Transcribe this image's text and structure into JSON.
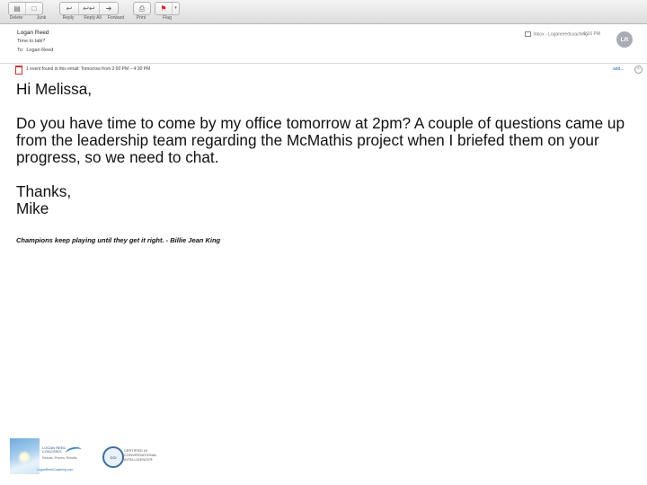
{
  "toolbar": {
    "delete": "Delete",
    "junk": "Junk",
    "reply": "Reply",
    "reply_all": "Reply All",
    "forward": "Forward",
    "print": "Print",
    "flag": "Flag"
  },
  "header": {
    "sender": "Logan Reed",
    "subject": "Time to talk?",
    "to_label": "To:",
    "to_name": "Logan Reed",
    "mailbox": "Inbox - Loganreedcoaching",
    "time": "6:16 PM",
    "avatar_initials": "LR"
  },
  "event_bar": {
    "text": "1 event found in this email: Tomorrow from 2:00 PM – 4:30 PM",
    "add": "add..."
  },
  "body": {
    "greeting": "Hi Melissa,",
    "paragraph": "Do you have time to come by my office tomorrow at 2pm?  A couple of questions came up from the leadership team regarding the McMathis project when I briefed them on your progress, so we need to chat.",
    "closing": "Thanks,",
    "name": "Mike",
    "quote": "Champions keep playing until they get it right. - Billie Jean King"
  },
  "signature": {
    "brand_name": "LOGAN REED COACHING",
    "brand_tagline": "Results. Proven. Results.",
    "brand_url": "LoganReedCoaching.com",
    "cert_seal": "CCI",
    "cert_text": "CERTIFIED IN CONVERSATIONAL INTELLIGENCE®"
  }
}
